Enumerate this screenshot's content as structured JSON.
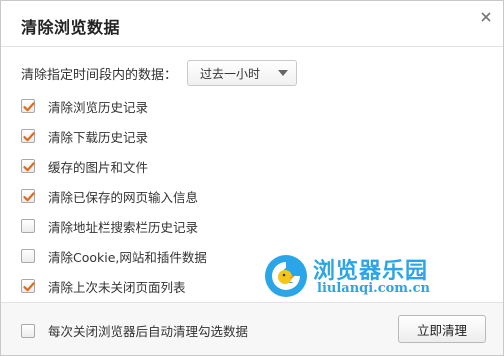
{
  "dialog": {
    "title": "清除浏览数据",
    "close_icon": "close-icon"
  },
  "time_range": {
    "label": "清除指定时间段内的数据：",
    "selected": "过去一小时"
  },
  "options": [
    {
      "label": "清除浏览历史记录",
      "checked": true
    },
    {
      "label": "清除下载历史记录",
      "checked": true
    },
    {
      "label": "缓存的图片和文件",
      "checked": true
    },
    {
      "label": "清除已保存的网页输入信息",
      "checked": true
    },
    {
      "label": "清除地址栏搜索栏历史记录",
      "checked": false
    },
    {
      "label": "清除Cookie,网站和插件数据",
      "checked": false
    },
    {
      "label": "清除上次未关闭页面列表",
      "checked": true
    }
  ],
  "footer": {
    "auto_clear_label": "每次关闭浏览器后自动清理勾选数据",
    "auto_clear_checked": false,
    "clear_button": "立即清理"
  },
  "watermark": {
    "name": "浏览器乐园",
    "url": "liulanqi.com.cn"
  },
  "colors": {
    "checkmark": "#e06a1b",
    "watermark": "#2aa5e8"
  }
}
